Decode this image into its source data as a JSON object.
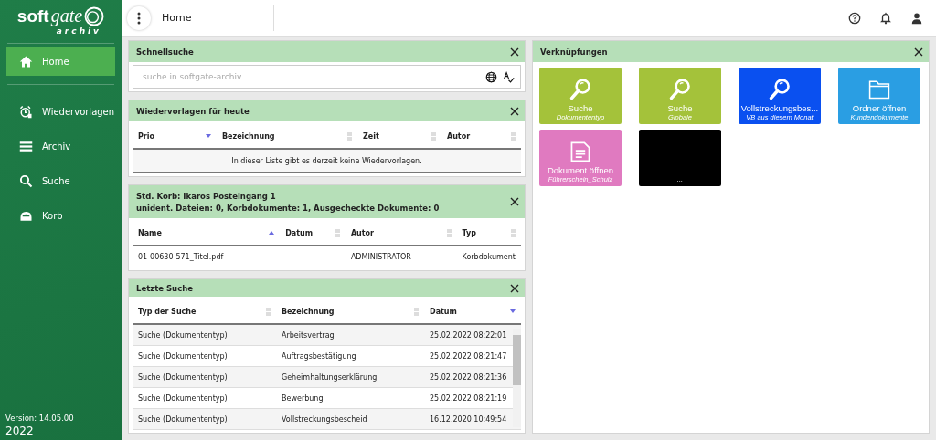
{
  "logo": {
    "brand_1": "soft",
    "brand_2": "gate",
    "sub": "archiv"
  },
  "sidebar": {
    "items": [
      {
        "label": "Home",
        "kind": "home",
        "selected": true
      },
      {
        "label": "Wiedervorlagen",
        "kind": "alarm",
        "selected": false
      },
      {
        "label": "Archiv",
        "kind": "list",
        "selected": false
      },
      {
        "label": "Suche",
        "kind": "search",
        "selected": false
      },
      {
        "label": "Korb",
        "kind": "tray",
        "selected": false
      }
    ],
    "version": "Version: 14.05.00",
    "year": "2022"
  },
  "topbar": {
    "title": "Home"
  },
  "quick_search": {
    "title": "Schnellsuche",
    "placeholder": "suche in softgate-archiv..."
  },
  "followups": {
    "title": "Wiedervorlagen für heute",
    "columns": [
      {
        "label": "Prio",
        "sorted": true,
        "ascending": false
      },
      {
        "label": "Bezeichnung",
        "sorted": false
      },
      {
        "label": "Zeit",
        "sorted": false
      },
      {
        "label": "Autor",
        "sorted": false
      }
    ],
    "empty": "In dieser Liste gibt es derzeit keine Wiedervorlagen."
  },
  "basket": {
    "title": "Std. Korb: Ikaros Posteingang 1",
    "subtitle": "unident. Dateien: 0, Korbdokumente: 1, Ausgecheckte Dokumente: 0",
    "columns": [
      {
        "label": "Name",
        "sorted": true,
        "ascending": true
      },
      {
        "label": "Datum",
        "sorted": false
      },
      {
        "label": "Autor",
        "sorted": false
      },
      {
        "label": "Typ",
        "sorted": false
      }
    ],
    "rows": [
      [
        "01-00630-571_Titel.pdf",
        "-",
        "ADMINISTRATOR",
        "Korbdokument"
      ]
    ]
  },
  "recent": {
    "title": "Letzte Suche",
    "columns": [
      {
        "label": "Typ der Suche",
        "sorted": false
      },
      {
        "label": "Bezeichnung",
        "sorted": false
      },
      {
        "label": "Datum",
        "sorted": true,
        "ascending": false
      }
    ],
    "rows": [
      [
        "Suche (Dokumententyp)",
        "Arbeitsvertrag",
        "25.02.2022 08:22:01"
      ],
      [
        "Suche (Dokumententyp)",
        "Auftragsbestätigung",
        "25.02.2022 08:21:47"
      ],
      [
        "Suche (Dokumententyp)",
        "Geheimhaltungserklärung",
        "25.02.2022 08:21:36"
      ],
      [
        "Suche (Dokumententyp)",
        "Bewerbung",
        "25.02.2022 08:21:19"
      ],
      [
        "Suche (Dokumententyp)",
        "Vollstreckungsbescheid",
        "16.12.2020 10:49:54"
      ]
    ]
  },
  "shortcuts": {
    "title": "Verknüpfungen",
    "tiles": [
      {
        "title": "Suche",
        "subtitle": "Dokumententyp",
        "kind": "search",
        "color": "#a4c23a"
      },
      {
        "title": "Suche",
        "subtitle": "Globale",
        "kind": "search",
        "color": "#a4c23a"
      },
      {
        "title": "Vollstreckungsbes...",
        "subtitle": "VB aus diesem Monat",
        "kind": "search",
        "color": "#0a50f0"
      },
      {
        "title": "Ordner öffnen",
        "subtitle": "Kundendokumente",
        "kind": "folder",
        "color": "#2a9ee3"
      },
      {
        "title": "Dokument öffnen",
        "subtitle": "Führerschein_Schulz",
        "kind": "document",
        "color": "#e07ac0"
      },
      {
        "subtitle": "...",
        "kind": "blank",
        "color": "#000000"
      }
    ]
  }
}
